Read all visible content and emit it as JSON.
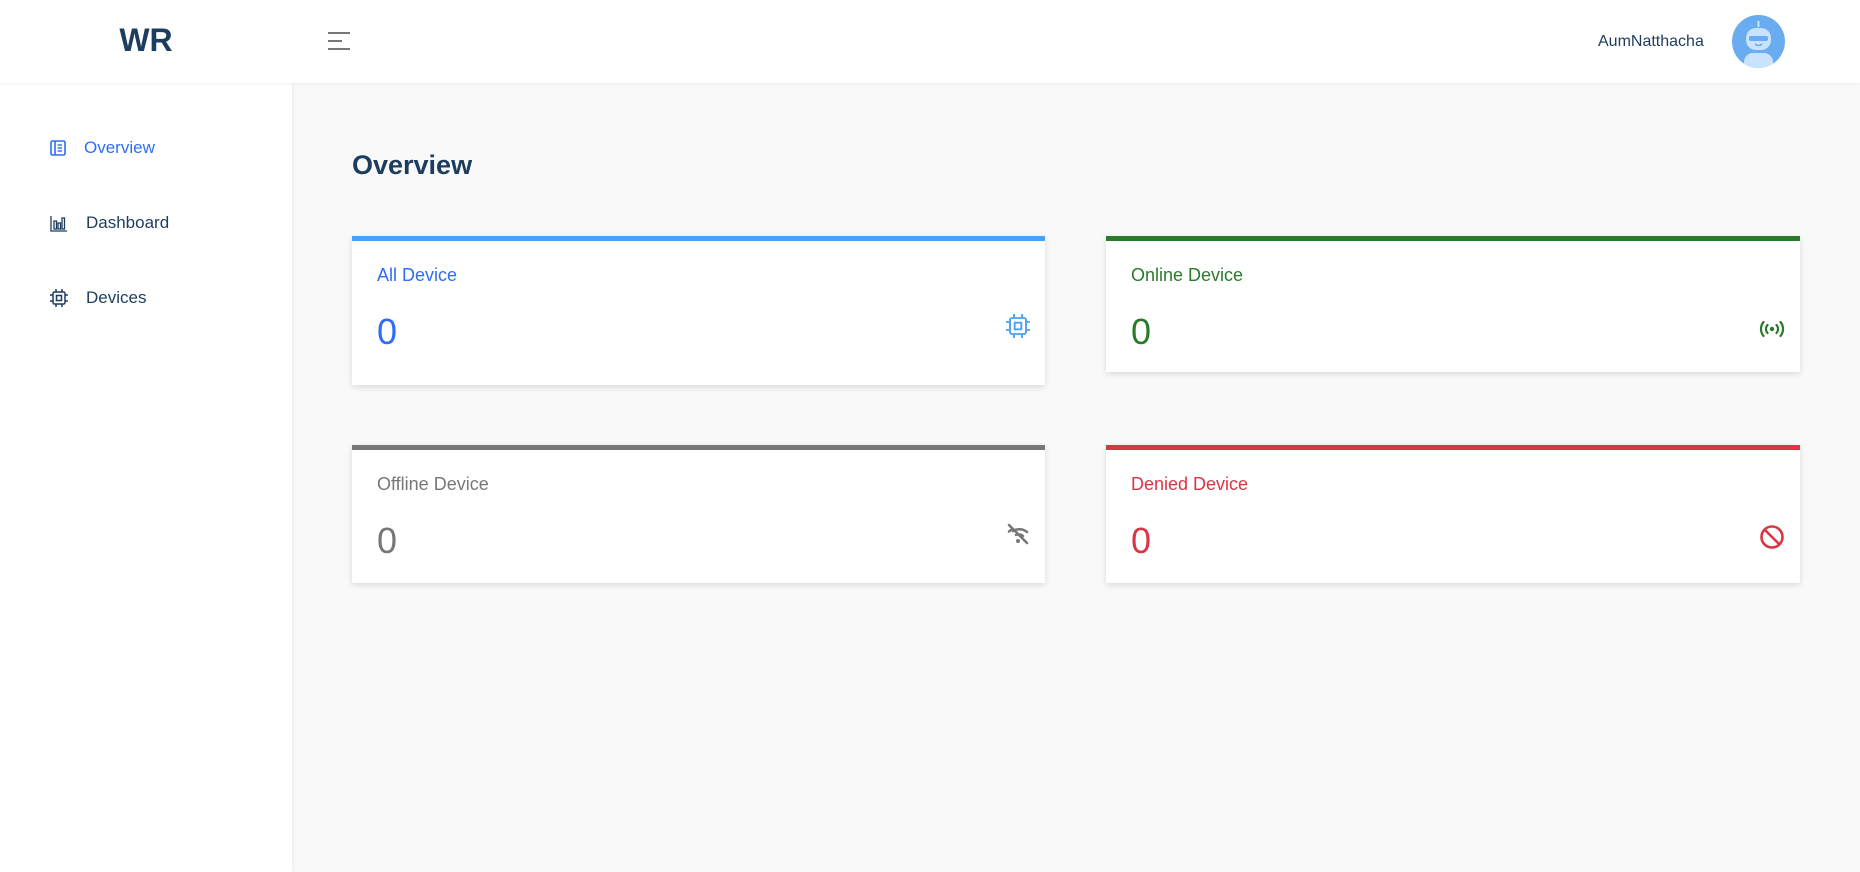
{
  "header": {
    "logo": "WR",
    "username": "AumNatthacha"
  },
  "sidebar": {
    "items": [
      {
        "label": "Overview",
        "icon": "overview-icon",
        "active": true
      },
      {
        "label": "Dashboard",
        "icon": "bar-chart-icon"
      },
      {
        "label": "Devices",
        "icon": "chip-icon"
      }
    ]
  },
  "main": {
    "title": "Overview",
    "cards": [
      {
        "label": "All Device",
        "value": "0",
        "color": "#2f6df6",
        "bar": "#4aa0f7",
        "icon": "chip-icon"
      },
      {
        "label": "Online Device",
        "value": "0",
        "color": "#2b7a2b",
        "bar": "#2b7a2b",
        "icon": "broadcast-icon"
      },
      {
        "label": "Offline Device",
        "value": "0",
        "color": "#777777",
        "bar": "#777777",
        "icon": "wifi-off-icon"
      },
      {
        "label": "Denied Device",
        "value": "0",
        "color": "#dc3545",
        "bar": "#dc3545",
        "icon": "ban-icon"
      }
    ]
  }
}
